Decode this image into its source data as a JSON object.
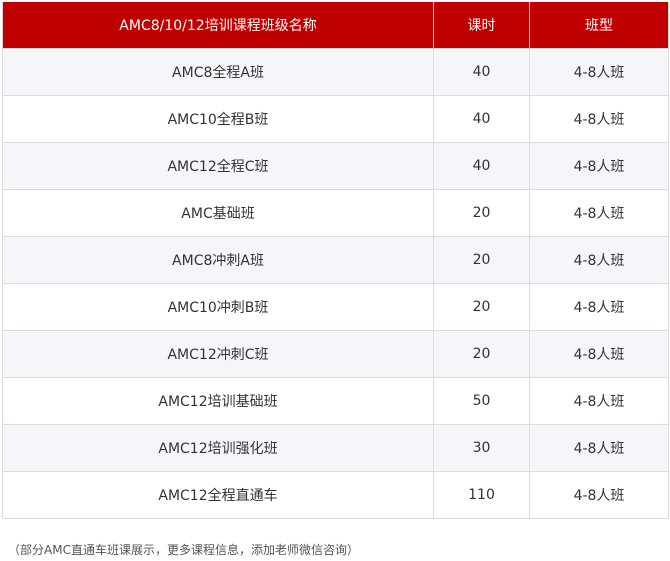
{
  "table": {
    "headers": [
      "AMC8/10/12培训课程班级名称",
      "课时",
      "班型"
    ],
    "rows": [
      [
        "AMC8全程A班",
        "40",
        "4-8人班"
      ],
      [
        "AMC10全程B班",
        "40",
        "4-8人班"
      ],
      [
        "AMC12全程C班",
        "40",
        "4-8人班"
      ],
      [
        "AMC基础班",
        "20",
        "4-8人班"
      ],
      [
        "AMC8冲刺A班",
        "20",
        "4-8人班"
      ],
      [
        "AMC10冲刺B班",
        "20",
        "4-8人班"
      ],
      [
        "AMC12冲刺C班",
        "20",
        "4-8人班"
      ],
      [
        "AMC12培训基础班",
        "50",
        "4-8人班"
      ],
      [
        "AMC12培训强化班",
        "30",
        "4-8人班"
      ],
      [
        "AMC12全程直通车",
        "110",
        "4-8人班"
      ]
    ]
  },
  "footnote": "（部分AMC直通车班课展示，更多课程信息，添加老师微信咨询）",
  "colors": {
    "header_bg": "#c00000",
    "header_text": "#ffffff",
    "row_alt_bg": "#f4f6fa",
    "border": "#dcdcdc"
  }
}
